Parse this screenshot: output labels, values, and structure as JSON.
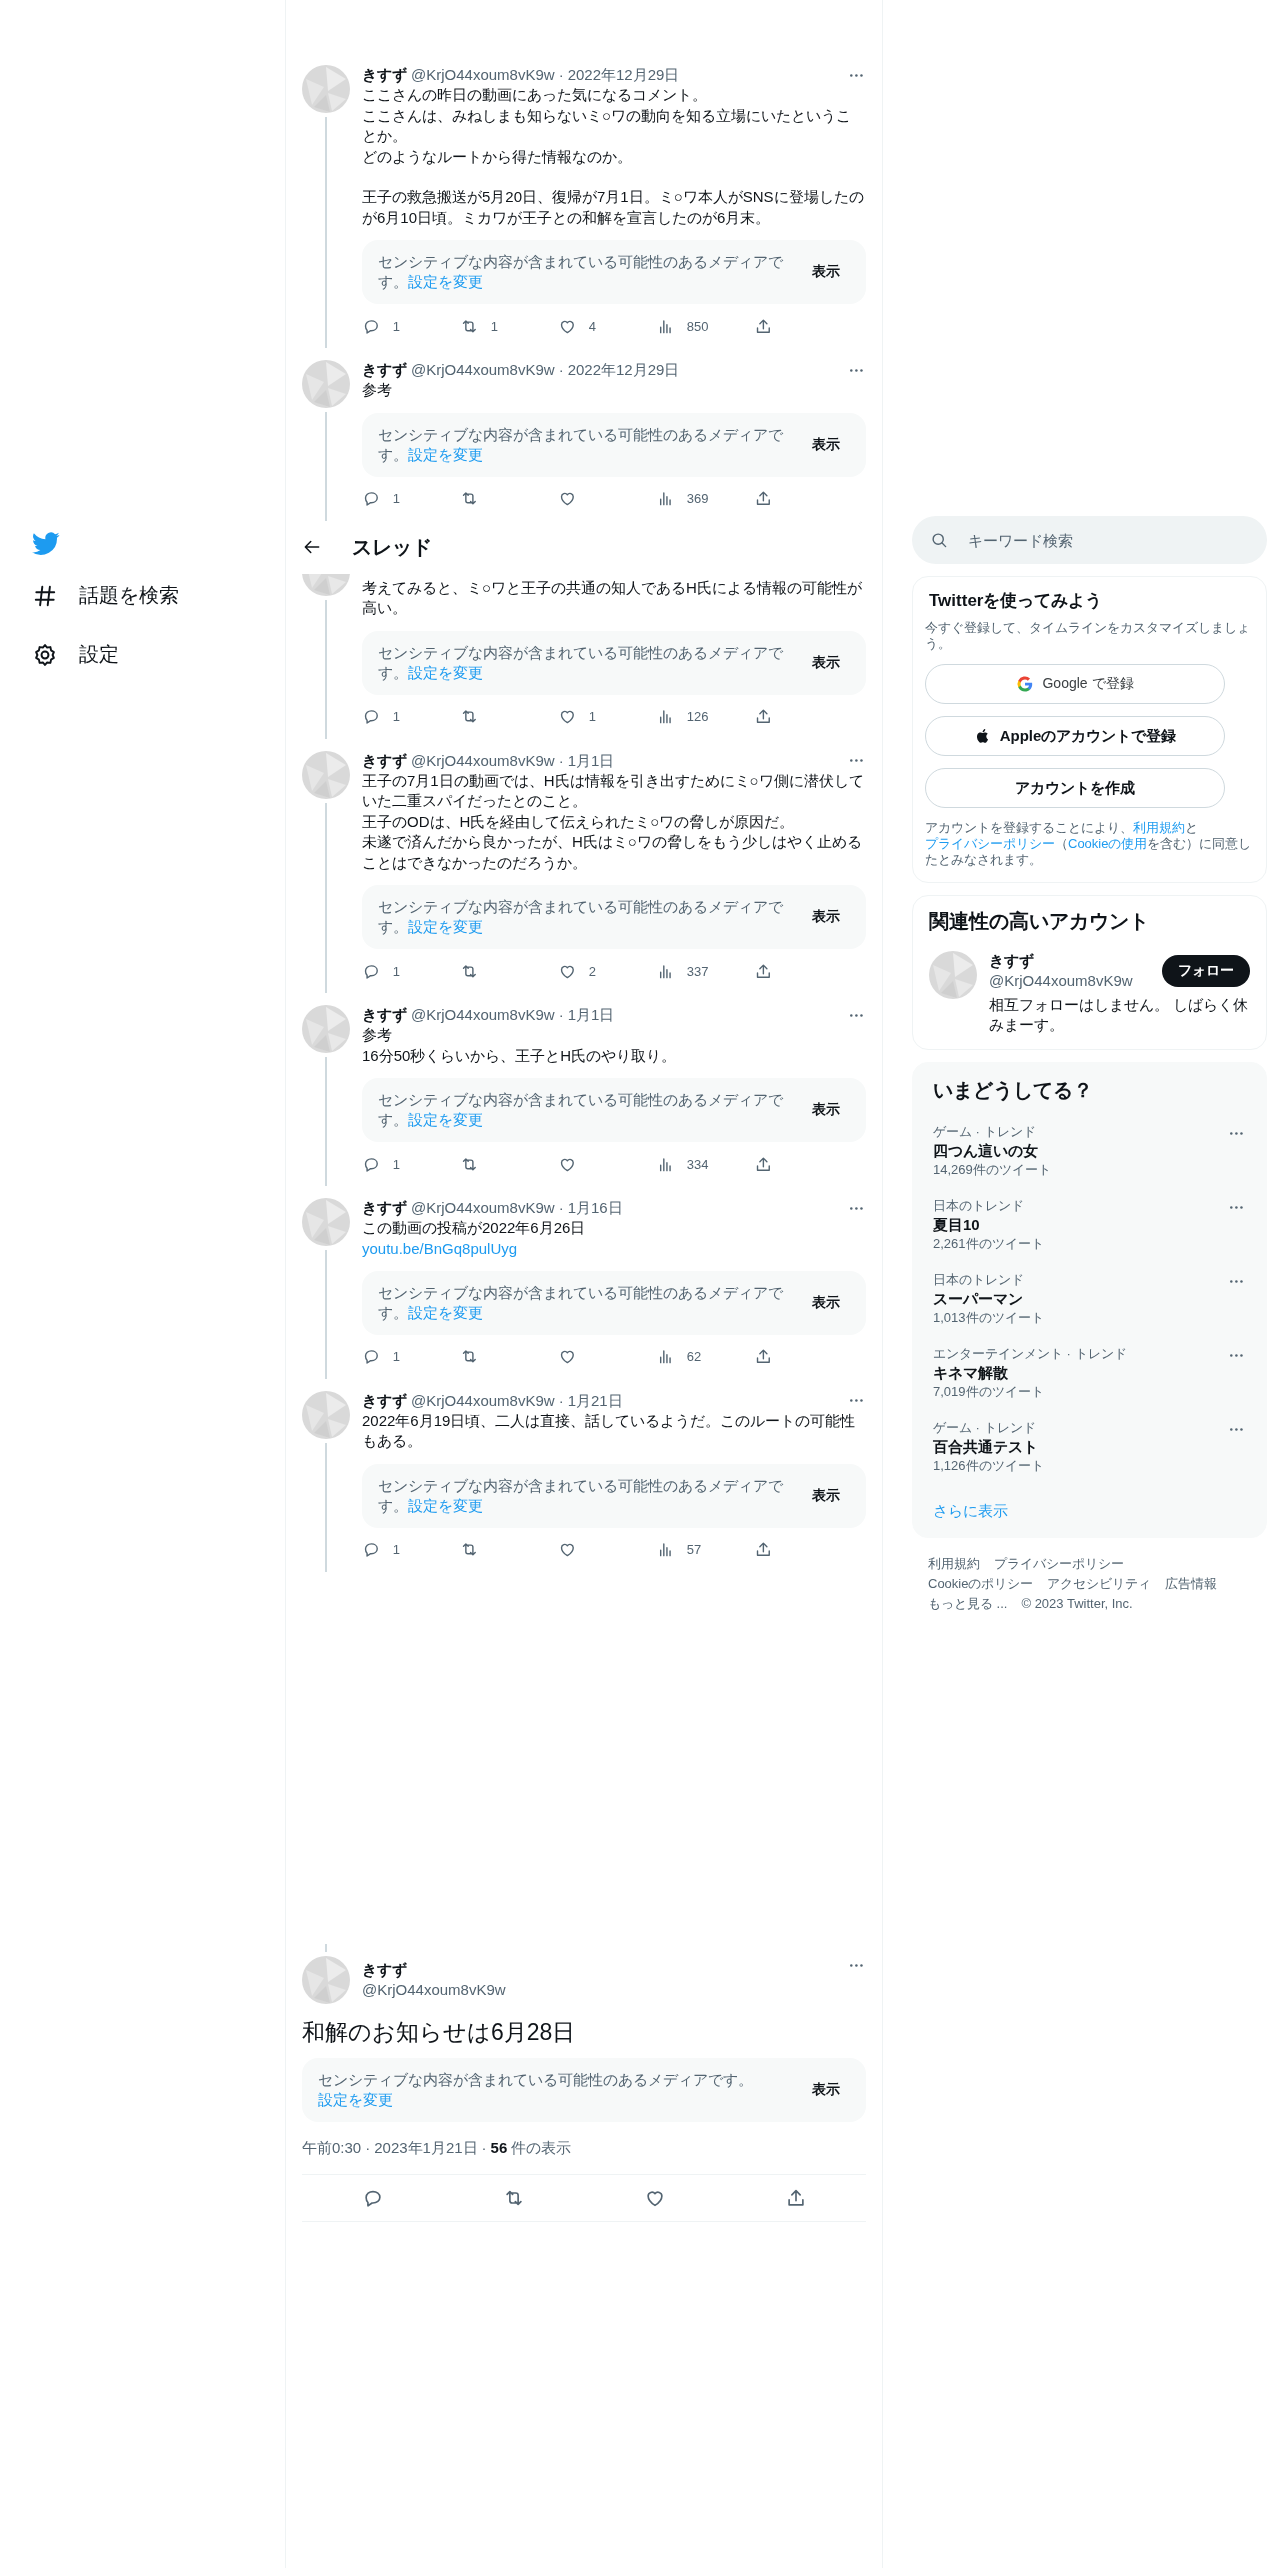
{
  "separator": "·",
  "nav": {
    "items": [
      {
        "kind": "hash",
        "label": "話題を検索"
      },
      {
        "kind": "gear",
        "label": "設定"
      }
    ]
  },
  "thread": {
    "header": {
      "title": "スレッド"
    },
    "tweets": [
      {
        "kind": "full",
        "name": "きすず",
        "handle": "@KrjO44xoum8vK9w",
        "date": "2022年12月29日",
        "text": [
          [
            "ここさんの昨日の動画にあった気になるコメント。",
            "ここさんは、みねしまも知らないミ○ワの動向を知る立場にいたということか。",
            "どのようなルートから得た情報なのか。"
          ],
          [
            "王子の救急搬送が5月20日、復帰が7月1日。ミ○ワ本人がSNSに登場したのが6月10日頃。ミカワが王子との和解を宣言したのが6月末。"
          ]
        ],
        "media_notice": {
          "text": "センシティブな内容が含まれている可能性のあるメディアです。",
          "link": "設定を変更",
          "button": "表示"
        },
        "stats": {
          "replies": "1",
          "retweets": "1",
          "likes": "4",
          "views": "850"
        }
      },
      {
        "kind": "full",
        "name": "きすず",
        "handle": "@KrjO44xoum8vK9w",
        "date": "2022年12月29日",
        "text": [
          [
            "参考"
          ]
        ],
        "media_notice": {
          "text": "センシティブな内容が含まれている可能性のあるメディアです。",
          "link": "設定を変更",
          "button": "表示"
        },
        "stats": {
          "replies": "1",
          "views": "369"
        }
      },
      {
        "kind": "continued",
        "text": [
          [
            "考えてみると、ミ○ワと王子の共通の知人であるH氏による情報の可能性が高い。"
          ]
        ],
        "media_notice": {
          "text": "センシティブな内容が含まれている可能性のあるメディアです。",
          "link": "設定を変更",
          "button": "表示"
        },
        "stats": {
          "replies": "1",
          "likes": "1",
          "views": "126"
        }
      },
      {
        "kind": "full",
        "name": "きすず",
        "handle": "@KrjO44xoum8vK9w",
        "date": "1月1日",
        "text": [
          [
            "王子の7月1日の動画では、H氏は情報を引き出すためにミ○ワ側に潜伏していた二重スパイだったとのこと。",
            "王子のODは、H氏を経由して伝えられたミ○ワの脅しが原因だ。",
            "未遂で済んだから良かったが、H氏はミ○ワの脅しをもう少しはやく止めることはできなかったのだろうか。"
          ]
        ],
        "media_notice": {
          "text": "センシティブな内容が含まれている可能性のあるメディアです。",
          "link": "設定を変更",
          "button": "表示"
        },
        "stats": {
          "replies": "1",
          "likes": "2",
          "views": "337"
        }
      },
      {
        "kind": "full",
        "name": "きすず",
        "handle": "@KrjO44xoum8vK9w",
        "date": "1月1日",
        "text": [
          [
            "参考",
            "16分50秒くらいから、王子とH氏のやり取り。"
          ]
        ],
        "media_notice": {
          "text": "センシティブな内容が含まれている可能性のあるメディアです。",
          "link": "設定を変更",
          "button": "表示"
        },
        "stats": {
          "replies": "1",
          "views": "334"
        }
      },
      {
        "kind": "full",
        "name": "きすず",
        "handle": "@KrjO44xoum8vK9w",
        "date": "1月16日",
        "text": [
          [
            "この動画の投稿が2022年6月26日"
          ]
        ],
        "link": "youtu.be/BnGq8pulUyg",
        "media_notice": {
          "text": "センシティブな内容が含まれている可能性のあるメディアです。",
          "link": "設定を変更",
          "button": "表示"
        },
        "stats": {
          "replies": "1",
          "views": "62"
        }
      },
      {
        "kind": "full",
        "name": "きすず",
        "handle": "@KrjO44xoum8vK9w",
        "date": "1月21日",
        "text": [
          [
            "2022年6月19日頃、二人は直接、話しているようだ。このルートの可能性もある。"
          ]
        ],
        "media_notice": {
          "text": "センシティブな内容が含まれている可能性のあるメディアです。",
          "link": "設定を変更",
          "button": "表示"
        },
        "stats": {
          "replies": "1",
          "views": "57"
        }
      }
    ],
    "main": {
      "name": "きすず",
      "handle": "@KrjO44xoum8vK9w",
      "text": "和解のお知らせは6月28日",
      "media_notice": {
        "text": "センシティブな内容が含まれている可能性のあるメディアです。",
        "link": "設定を変更",
        "button": "表示"
      },
      "meta": {
        "time": "午前0:30",
        "date": "2023年1月21日",
        "views": "56",
        "views_label": "件の表示"
      }
    }
  },
  "search": {
    "placeholder": "キーワード検索"
  },
  "signup": {
    "title": "Twitterを使ってみよう",
    "subtitle": "今すぐ登録して、タイムラインをカスタマイズしましょう。",
    "buttons": [
      {
        "kind": "google",
        "label": "Google で登録"
      },
      {
        "kind": "apple",
        "label": "Appleのアカウントで登録"
      },
      {
        "kind": "plain",
        "label": "アカウントを作成"
      }
    ],
    "legal": [
      {
        "text": "アカウントを登録することにより、"
      },
      {
        "text": "利用規約",
        "link": true
      },
      {
        "text": "と"
      },
      {
        "text": "プライバシーポリシー",
        "link": true
      },
      {
        "text": "（"
      },
      {
        "text": "Cookieの使用",
        "link": true
      },
      {
        "text": "を含む）に同意したとみなされます。"
      }
    ]
  },
  "related": {
    "title": "関連性の高いアカウント",
    "accounts": [
      {
        "name": "きすず",
        "handle": "@KrjO44xoum8vK9w",
        "bio": "相互フォローはしません。 しばらく休みまーす。",
        "button": "フォロー"
      }
    ]
  },
  "trends": {
    "title": "いまどうしてる？",
    "items": [
      {
        "category": "ゲーム · トレンド",
        "name": "四つん這いの女",
        "count": "14,269件のツイート"
      },
      {
        "category": "日本のトレンド",
        "name": "夏目10",
        "count": "2,261件のツイート"
      },
      {
        "category": "日本のトレンド",
        "name": "スーパーマン",
        "count": "1,013件のツイート"
      },
      {
        "category": "エンターテインメント · トレンド",
        "name": "キネマ解散",
        "count": "7,019件のツイート"
      },
      {
        "category": "ゲーム · トレンド",
        "name": "百合共通テスト",
        "count": "1,126件のツイート"
      }
    ],
    "more": "さらに表示"
  },
  "footer": {
    "links": [
      "利用規約",
      "プライバシーポリシー",
      "Cookieのポリシー",
      "アクセシビリティ",
      "広告情報",
      "もっと見る ..."
    ],
    "copyright": "© 2023 Twitter, Inc."
  }
}
